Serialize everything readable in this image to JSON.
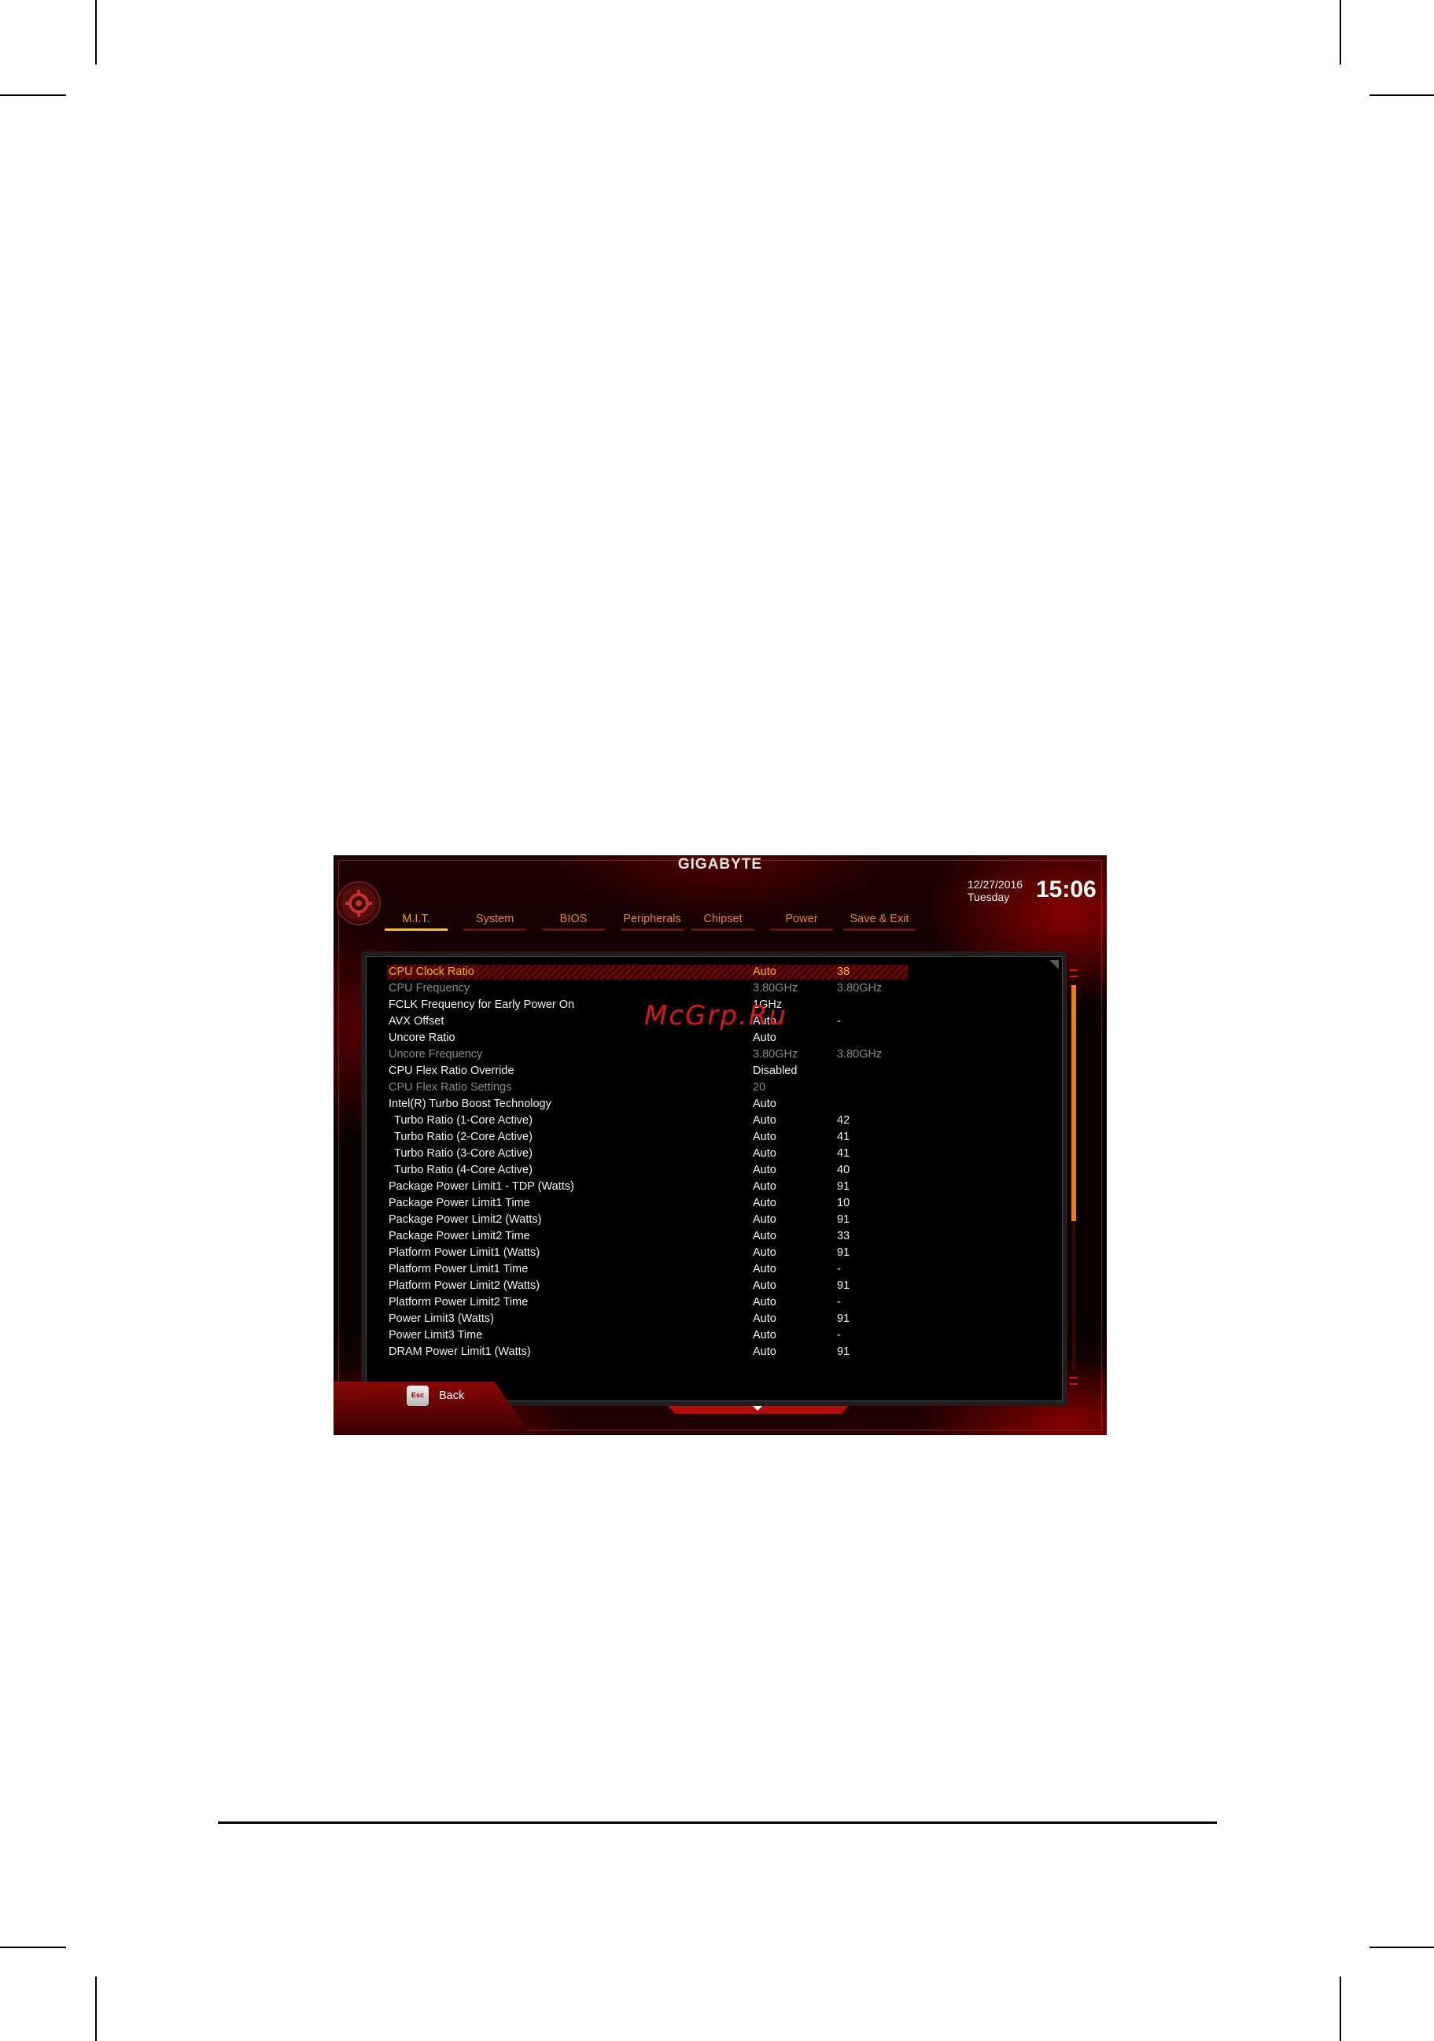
{
  "header": {
    "brand": "GIGABYTE",
    "date": "12/27/2016",
    "weekday": "Tuesday",
    "time": "15:06"
  },
  "tabs": [
    {
      "label": "M.I.T.",
      "active": true
    },
    {
      "label": "System",
      "active": false
    },
    {
      "label": "BIOS",
      "active": false
    },
    {
      "label": "Peripherals",
      "active": false
    },
    {
      "label": "Chipset",
      "active": false
    },
    {
      "label": "Power",
      "active": false
    },
    {
      "label": "Save & Exit",
      "active": false
    }
  ],
  "settings": [
    {
      "label": "CPU Clock Ratio",
      "value": "Auto",
      "current": "38",
      "state": "selected"
    },
    {
      "label": "CPU Frequency",
      "value": "3.80GHz",
      "current": "3.80GHz",
      "state": "dim"
    },
    {
      "label": "FCLK Frequency for Early Power On",
      "value": "1GHz",
      "current": "",
      "state": "normal"
    },
    {
      "label": "AVX Offset",
      "value": "Auto",
      "current": "-",
      "state": "normal"
    },
    {
      "label": "Uncore Ratio",
      "value": "Auto",
      "current": "",
      "state": "normal"
    },
    {
      "label": "Uncore Frequency",
      "value": "3.80GHz",
      "current": "3.80GHz",
      "state": "dim"
    },
    {
      "label": "CPU Flex Ratio Override",
      "value": "Disabled",
      "current": "",
      "state": "normal"
    },
    {
      "label": "CPU Flex Ratio Settings",
      "value": "20",
      "current": "",
      "state": "dim"
    },
    {
      "label": "Intel(R) Turbo Boost Technology",
      "value": "Auto",
      "current": "",
      "state": "normal"
    },
    {
      "label": "Turbo Ratio (1-Core Active)",
      "value": "Auto",
      "current": "42",
      "state": "sub"
    },
    {
      "label": "Turbo Ratio (2-Core Active)",
      "value": "Auto",
      "current": "41",
      "state": "sub"
    },
    {
      "label": "Turbo Ratio (3-Core Active)",
      "value": "Auto",
      "current": "41",
      "state": "sub"
    },
    {
      "label": "Turbo Ratio (4-Core Active)",
      "value": "Auto",
      "current": "40",
      "state": "sub"
    },
    {
      "label": "Package Power Limit1 - TDP (Watts)",
      "value": "Auto",
      "current": "91",
      "state": "normal"
    },
    {
      "label": "Package Power Limit1 Time",
      "value": "Auto",
      "current": "10",
      "state": "normal"
    },
    {
      "label": "Package Power Limit2 (Watts)",
      "value": "Auto",
      "current": "91",
      "state": "normal"
    },
    {
      "label": "Package Power Limit2 Time",
      "value": "Auto",
      "current": "33",
      "state": "normal"
    },
    {
      "label": "Platform Power Limit1 (Watts)",
      "value": "Auto",
      "current": "91",
      "state": "normal"
    },
    {
      "label": "Platform Power Limit1 Time",
      "value": "Auto",
      "current": "-",
      "state": "normal"
    },
    {
      "label": "Platform Power Limit2 (Watts)",
      "value": "Auto",
      "current": "91",
      "state": "normal"
    },
    {
      "label": "Platform Power Limit2 Time",
      "value": "Auto",
      "current": "-",
      "state": "normal"
    },
    {
      "label": "Power Limit3 (Watts)",
      "value": "Auto",
      "current": "91",
      "state": "normal"
    },
    {
      "label": "Power Limit3 Time",
      "value": "Auto",
      "current": "-",
      "state": "normal"
    },
    {
      "label": "DRAM Power Limit1 (Watts)",
      "value": "Auto",
      "current": "91",
      "state": "normal"
    }
  ],
  "footer": {
    "esc_key": "Esc",
    "back_label": "Back"
  },
  "watermark": "McGrp.Ru",
  "colors": {
    "accent": "#ffa31a",
    "tab_text": "#e8852a",
    "scroll_thumb": "#f07a18",
    "frame_red": "#b00d0d"
  }
}
